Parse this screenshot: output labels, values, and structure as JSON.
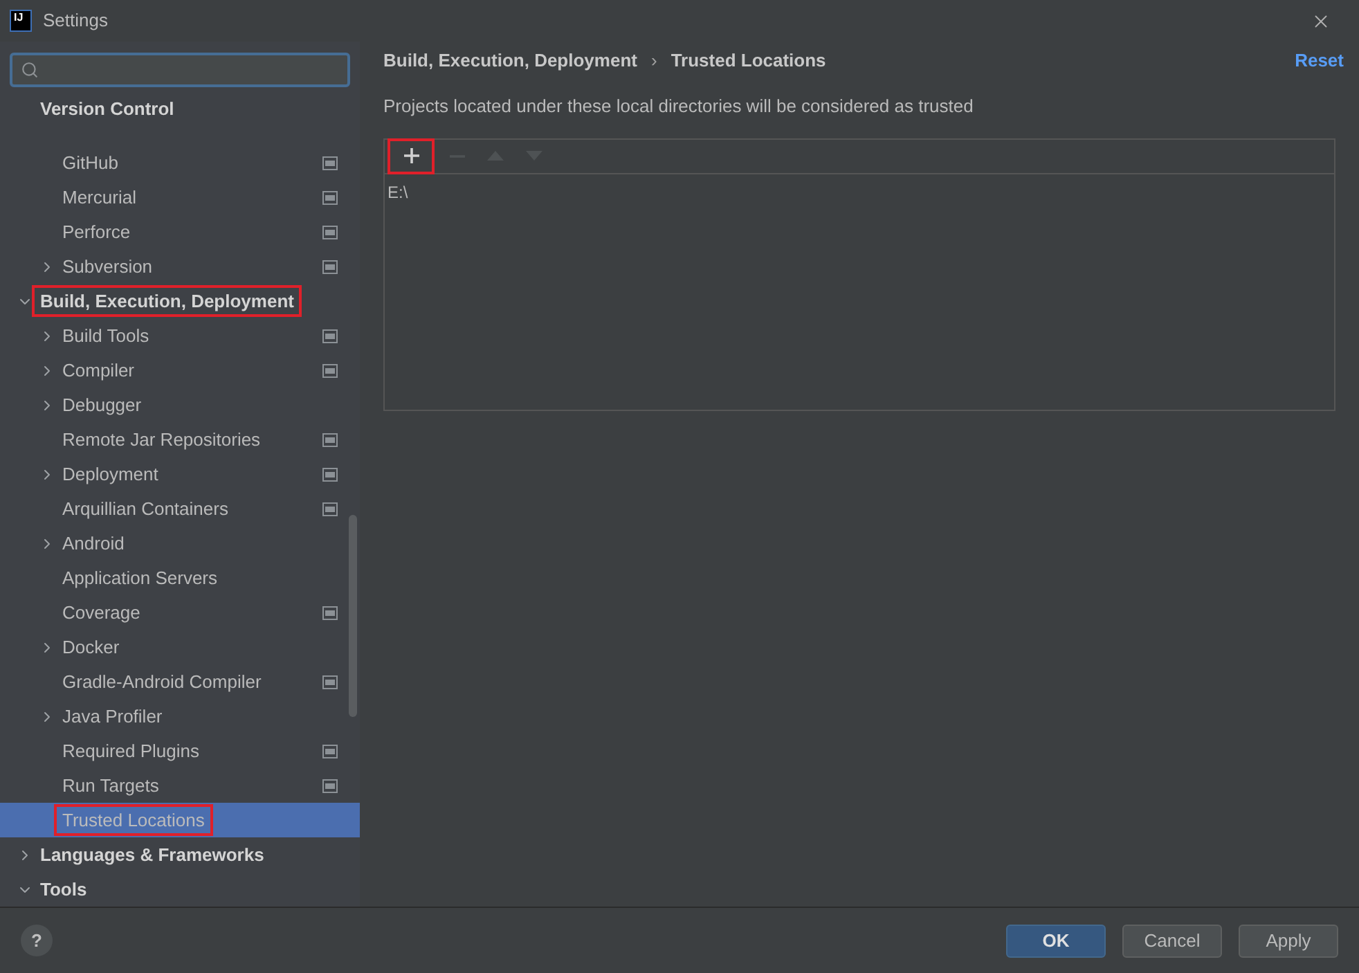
{
  "window": {
    "logo": "IJ",
    "title": "Settings"
  },
  "sidebar": {
    "sticky_header": "Version Control",
    "items": [
      {
        "label": "GitHub",
        "project_scope": true,
        "selected": false,
        "annotated": false
      },
      {
        "label": "Mercurial",
        "project_scope": true,
        "selected": false,
        "annotated": false
      },
      {
        "label": "Perforce",
        "project_scope": true,
        "selected": false,
        "annotated": false
      },
      {
        "label": "Subversion",
        "expanded": false,
        "project_scope": true,
        "selected": false,
        "annotated": false
      },
      {
        "label": "Build, Execution, Deployment",
        "expanded": true,
        "top": true,
        "selected": false,
        "annotated": true,
        "children": [
          {
            "label": "Build Tools",
            "expanded": false,
            "project_scope": true,
            "selected": false,
            "annotated": false
          },
          {
            "label": "Compiler",
            "expanded": false,
            "project_scope": true,
            "selected": false,
            "annotated": false
          },
          {
            "label": "Debugger",
            "expanded": false,
            "project_scope": false,
            "selected": false,
            "annotated": false
          },
          {
            "label": "Remote Jar Repositories",
            "project_scope": true,
            "selected": false,
            "annotated": false
          },
          {
            "label": "Deployment",
            "expanded": false,
            "project_scope": true,
            "selected": false,
            "annotated": false
          },
          {
            "label": "Arquillian Containers",
            "project_scope": true,
            "selected": false,
            "annotated": false
          },
          {
            "label": "Android",
            "expanded": false,
            "project_scope": false,
            "selected": false,
            "annotated": false
          },
          {
            "label": "Application Servers",
            "project_scope": false,
            "selected": false,
            "annotated": false
          },
          {
            "label": "Coverage",
            "project_scope": true,
            "selected": false,
            "annotated": false
          },
          {
            "label": "Docker",
            "expanded": false,
            "project_scope": false,
            "selected": false,
            "annotated": false
          },
          {
            "label": "Gradle-Android Compiler",
            "project_scope": true,
            "selected": false,
            "annotated": false
          },
          {
            "label": "Java Profiler",
            "expanded": false,
            "project_scope": false,
            "selected": false,
            "annotated": false
          },
          {
            "label": "Required Plugins",
            "project_scope": true,
            "selected": false,
            "annotated": false
          },
          {
            "label": "Run Targets",
            "project_scope": true,
            "selected": false,
            "annotated": false
          },
          {
            "label": "Trusted Locations",
            "project_scope": false,
            "selected": true,
            "annotated": true
          }
        ]
      },
      {
        "label": "Languages & Frameworks",
        "expanded": false,
        "top": true,
        "selected": false,
        "annotated": false
      },
      {
        "label": "Tools",
        "expanded": true,
        "top": true,
        "selected": false,
        "annotated": false
      }
    ]
  },
  "content": {
    "breadcrumb": [
      "Build, Execution, Deployment",
      "Trusted Locations"
    ],
    "separator": "›",
    "reset": "Reset",
    "description": "Projects located under these local directories will be considered as trusted",
    "toolbar": [
      {
        "kind": "add",
        "disabled": false,
        "annotated": true
      },
      {
        "kind": "remove",
        "disabled": true,
        "annotated": false
      },
      {
        "kind": "up",
        "disabled": true,
        "annotated": false
      },
      {
        "kind": "down",
        "disabled": true,
        "annotated": false
      }
    ],
    "locations": [
      "E:\\"
    ]
  },
  "footer": {
    "help": "?",
    "buttons": [
      {
        "label": "OK",
        "kind": "primary"
      },
      {
        "label": "Cancel",
        "kind": "secondary"
      },
      {
        "label": "Apply",
        "kind": "secondary"
      }
    ]
  }
}
